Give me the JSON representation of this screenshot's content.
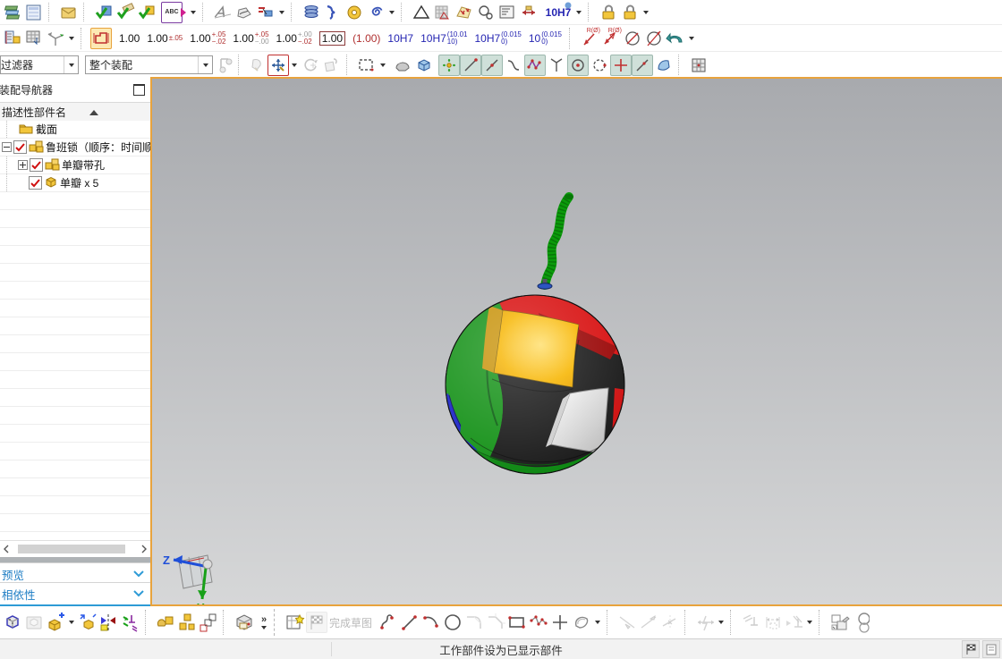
{
  "toolbars": {
    "row1": {
      "text_tool_label": "ABC",
      "fit_value": "10H7"
    },
    "row2": {
      "buttons": [
        {
          "main": "1.00"
        },
        {
          "main": "1.00",
          "sup": "±.05"
        },
        {
          "main": "1.00",
          "sup": "+.05",
          "sub": "−.02"
        },
        {
          "main": "1.00",
          "sup": "+.05",
          "sub": "−.00"
        },
        {
          "main": "1.00",
          "sup": "+.00",
          "sub": "−.02"
        },
        {
          "main": "1.00"
        },
        {
          "main": "(1.00)"
        },
        {
          "main": "10H7"
        },
        {
          "main": "10H7",
          "sup": "(10.01",
          "sub": "10)"
        },
        {
          "main": "10H7",
          "sup": "(0.015",
          "sub": "0)"
        },
        {
          "main": "10",
          "sup": "(0.015",
          "sub": "0)"
        }
      ],
      "radius_label": "R(Ø)"
    },
    "row3": {
      "filter_value": "过滤器",
      "scope_value": "整个装配"
    }
  },
  "assembly_navigator": {
    "title": "装配导航器",
    "column_header": "描述性部件名",
    "tree": [
      {
        "label": "截面"
      },
      {
        "label": "鲁班锁（顺序：时间顺"
      },
      {
        "label": "单瓣带孔"
      },
      {
        "label": "单瓣 x 5"
      }
    ],
    "sections": [
      {
        "label": "预览"
      },
      {
        "label": "相依性"
      }
    ]
  },
  "viewport": {
    "triad": {
      "z": "Z",
      "y": "Y"
    }
  },
  "bottom_toolbar": {
    "finish_sketch_label": "完成草图",
    "expand_label": "»"
  },
  "status_bar": {
    "message": "工作部件设为已显示部件"
  },
  "colors": {
    "view_border": "#e8a33d",
    "ball_red": "#d81010",
    "ball_green": "#169219",
    "ball_yellow": "#f7b500",
    "ball_blue": "#1c24c8",
    "ball_black": "#1b1b1b",
    "ball_white": "#e9e9e9",
    "rope_green": "#0b9b0b",
    "section_text": "#1d7dc4"
  }
}
